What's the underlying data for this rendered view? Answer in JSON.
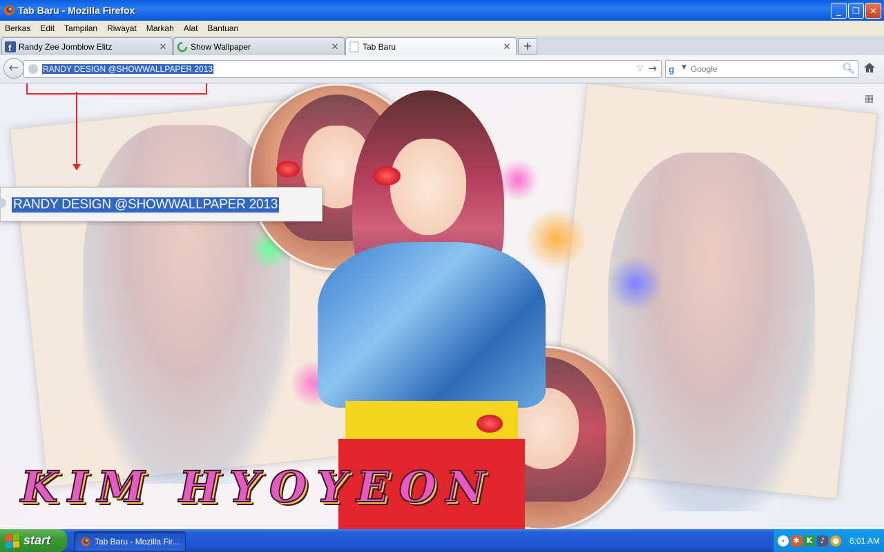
{
  "window": {
    "title": "Tab Baru - Mozilla Firefox",
    "controls": {
      "minimize": "_",
      "maximize": "❐",
      "close": "✕"
    }
  },
  "menu": {
    "items": [
      "Berkas",
      "Edit",
      "Tampilan",
      "Riwayat",
      "Markah",
      "Alat",
      "Bantuan"
    ]
  },
  "tabs": [
    {
      "label": "Randy Zee Jomblow Elitz",
      "icon": "facebook-icon"
    },
    {
      "label": "Show Wallpaper",
      "icon": "loading-icon"
    },
    {
      "label": "Tab Baru",
      "icon": "blank-page-icon",
      "active": true
    }
  ],
  "navbar": {
    "url": "RANDY DESIGN @SHOWWALLPAPER 2013",
    "search_placeholder": "Google"
  },
  "wallpaper": {
    "zoomed_url_text": "RANDY DESIGN @SHOWWALLPAPER 2013",
    "title": "KIM HYOYEON"
  },
  "taskbar": {
    "start_label": "start",
    "task_label": "Tab Baru - Mozilla Fir...",
    "clock": "6:01 AM"
  },
  "colors": {
    "selection": "#3166c7",
    "title_magenta": "#e65ac3",
    "highlight_red": "#e22222",
    "xp_blue": "#245edb",
    "start_green": "#3c9a36"
  }
}
